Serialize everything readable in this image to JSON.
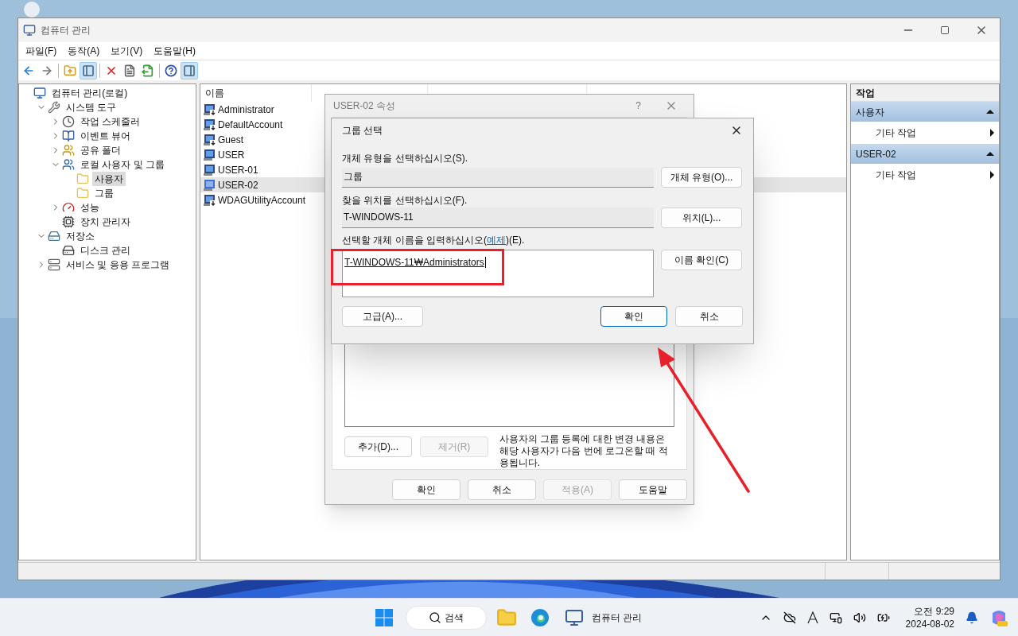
{
  "window": {
    "title": "컴퓨터 관리"
  },
  "menu": [
    "파일(F)",
    "동작(A)",
    "보기(V)",
    "도움말(H)"
  ],
  "toolbar": [
    {
      "kind": "back",
      "on": false
    },
    {
      "kind": "forward",
      "on": false
    },
    {
      "kind": "sep"
    },
    {
      "kind": "up",
      "on": false
    },
    {
      "kind": "tree",
      "on": true
    },
    {
      "kind": "sep"
    },
    {
      "kind": "delete",
      "on": false
    },
    {
      "kind": "props",
      "on": false
    },
    {
      "kind": "export",
      "on": false
    },
    {
      "kind": "sep"
    },
    {
      "kind": "help",
      "on": false
    },
    {
      "kind": "actions",
      "on": true
    }
  ],
  "tree": [
    {
      "label": "컴퓨터 관리(로컬)",
      "kind": "computer",
      "selected": false,
      "children": [
        {
          "label": "시스템 도구",
          "kind": "tools",
          "selected": false,
          "expanded": true,
          "children": [
            {
              "label": "작업 스케줄러",
              "kind": "clock",
              "selected": false,
              "expanded": false
            },
            {
              "label": "이벤트 뷰어",
              "kind": "event",
              "selected": false,
              "expanded": false
            },
            {
              "label": "공유 폴더",
              "kind": "share",
              "selected": false,
              "expanded": false
            },
            {
              "label": "로컬 사용자 및 그룹",
              "kind": "users",
              "selected": false,
              "expanded": true,
              "children": [
                {
                  "label": "사용자",
                  "kind": "folder",
                  "selected": true
                },
                {
                  "label": "그룹",
                  "kind": "folder",
                  "selected": false
                }
              ]
            },
            {
              "label": "성능",
              "kind": "perf",
              "selected": false,
              "expanded": false
            },
            {
              "label": "장치 관리자",
              "kind": "device",
              "selected": false
            }
          ]
        },
        {
          "label": "저장소",
          "kind": "storage",
          "selected": false,
          "expanded": true,
          "children": [
            {
              "label": "디스크 관리",
              "kind": "disk",
              "selected": false
            }
          ]
        },
        {
          "label": "서비스 및 응용 프로그램",
          "kind": "services",
          "selected": false,
          "expanded": false
        }
      ]
    }
  ],
  "list": {
    "columns": [
      "이름"
    ],
    "rows": [
      {
        "name": "Administrator",
        "disabled": true,
        "selected": false
      },
      {
        "name": "DefaultAccount",
        "disabled": true,
        "selected": false
      },
      {
        "name": "Guest",
        "disabled": true,
        "selected": false
      },
      {
        "name": "USER",
        "disabled": false,
        "selected": false
      },
      {
        "name": "USER-01",
        "disabled": false,
        "selected": false
      },
      {
        "name": "USER-02",
        "disabled": false,
        "selected": true
      },
      {
        "name": "WDAGUtilityAccount",
        "disabled": true,
        "selected": false
      }
    ]
  },
  "actions": {
    "title": "작업",
    "sections": [
      {
        "title": "사용자",
        "expanded": true,
        "items": [
          "기타 작업"
        ]
      },
      {
        "title": "USER-02",
        "expanded": true,
        "items": [
          "기타 작업"
        ]
      }
    ]
  },
  "properties_dialog": {
    "title": "USER-02 속성",
    "help": "?",
    "buttons_row": [
      {
        "label": "추가(D)...",
        "disabled": false
      },
      {
        "label": "제거(R)",
        "disabled": true
      }
    ],
    "note": "사용자의 그룹 등록에 대한 변경 내용은 해당 사용자가 다음 번에 로그온할 때 적용됩니다.",
    "buttons": [
      {
        "label": "확인",
        "disabled": false
      },
      {
        "label": "취소",
        "disabled": false
      },
      {
        "label": "적용(A)",
        "disabled": true
      },
      {
        "label": "도움말",
        "disabled": false
      }
    ]
  },
  "group_dialog": {
    "title": "그룹 선택",
    "type_label": "개체 유형을 선택하십시오(S).",
    "type_value": "그룹",
    "type_button": "개체 유형(O)...",
    "location_label": "찾을 위치를 선택하십시오(F).",
    "location_value": "T-WINDOWS-11",
    "location_button": "위치(L)...",
    "name_label_before": "선택할 개체 이름을 입력하십시오(",
    "name_label_link": "예제",
    "name_label_after": ")(E).",
    "name_value": "T-WINDOWS-11₩Administrators",
    "check_button": "이름 확인(C)",
    "advanced_button": "고급(A)...",
    "ok_button": "확인",
    "cancel_button": "취소"
  },
  "taskbar": {
    "search": "검색",
    "app_label": "컴퓨터 관리",
    "time": "오전 9:29",
    "date": "2024-08-02"
  }
}
